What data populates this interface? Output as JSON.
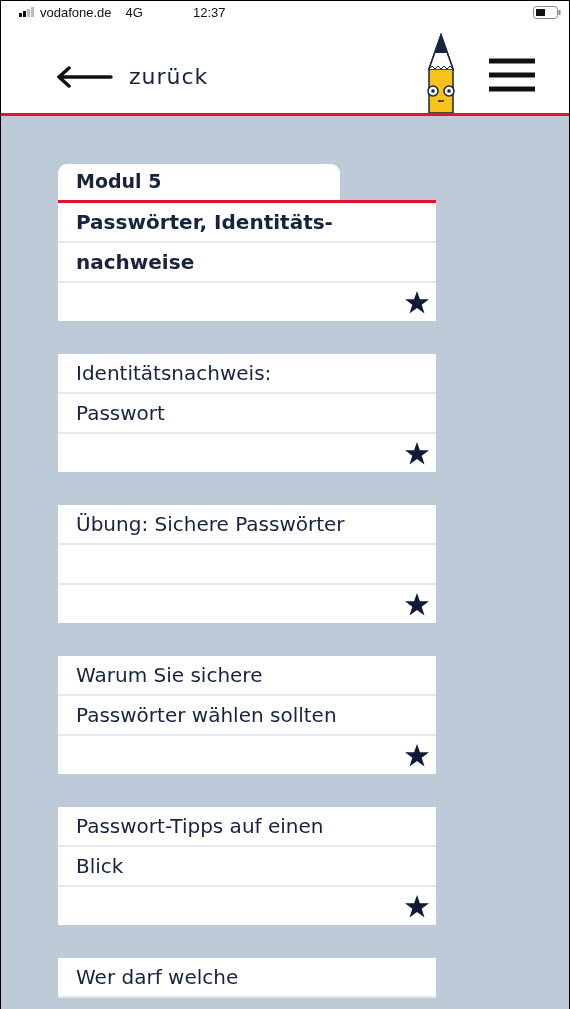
{
  "status_bar": {
    "carrier": "vodafone.de",
    "network": "4G",
    "time": "12:37"
  },
  "header": {
    "back_label": "zurück"
  },
  "module": {
    "tab": "Modul 5",
    "title_lines": [
      "Passwörter, Identitäts-",
      "nachweise"
    ],
    "stars": 1
  },
  "lessons": [
    {
      "lines": [
        "Identitätsnachweis:",
        "Passwort"
      ],
      "stars": 1
    },
    {
      "lines": [
        "Übung: Sichere Passwörter"
      ],
      "stars": 1
    },
    {
      "lines": [
        "Warum Sie sichere",
        "Passwörter wählen sollten"
      ],
      "stars": 1
    },
    {
      "lines": [
        "Passwort-Tipps auf einen",
        "Blick"
      ],
      "stars": 1
    },
    {
      "lines": [
        "Wer darf welche"
      ]
    }
  ]
}
